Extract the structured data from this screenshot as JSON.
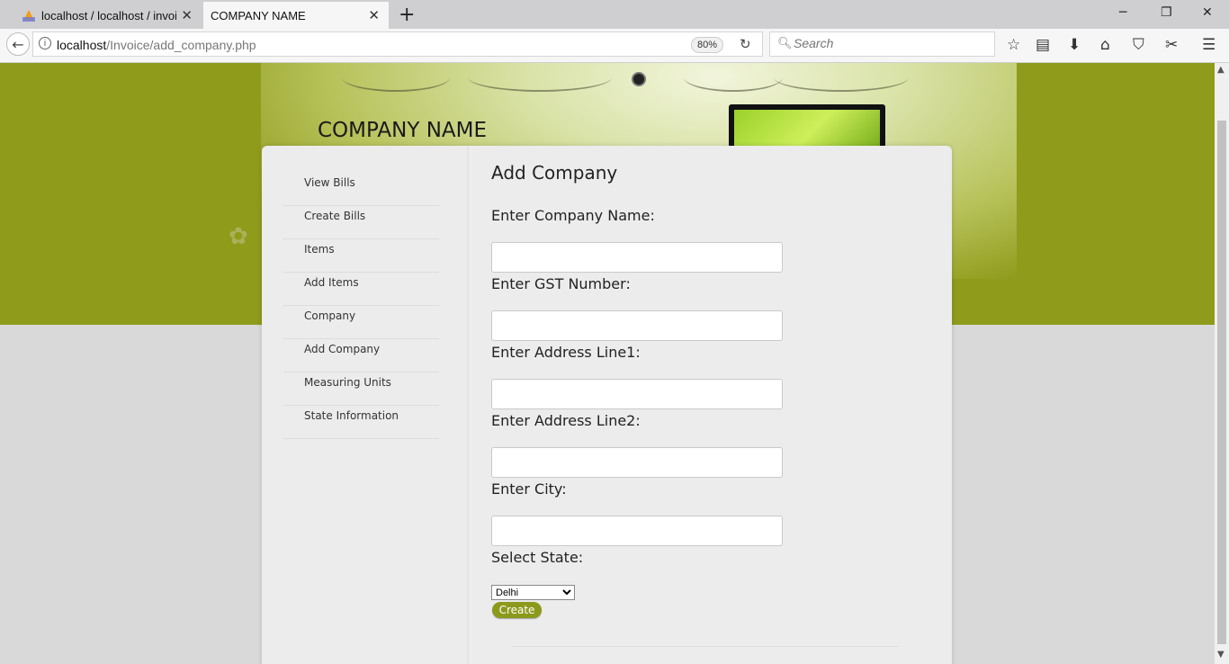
{
  "browser": {
    "tabs": [
      {
        "title": "localhost / localhost / invoice"
      },
      {
        "title": "COMPANY NAME"
      }
    ],
    "url_host": "localhost",
    "url_path": "/Invoice/add_company.php",
    "zoom": "80%",
    "search_placeholder": "Search"
  },
  "page": {
    "company_name": "COMPANY NAME",
    "heading": "Add Company",
    "nav": [
      {
        "label": "View Bills"
      },
      {
        "label": "Create Bills"
      },
      {
        "label": "Items"
      },
      {
        "label": "Add Items"
      },
      {
        "label": "Company"
      },
      {
        "label": "Add Company"
      },
      {
        "label": "Measuring Units"
      },
      {
        "label": "State Information"
      }
    ],
    "fields": [
      {
        "label": "Enter Company Name:",
        "value": ""
      },
      {
        "label": "Enter GST Number:",
        "value": ""
      },
      {
        "label": "Enter Address Line1:",
        "value": ""
      },
      {
        "label": "Enter Address Line2:",
        "value": ""
      },
      {
        "label": "Enter City:",
        "value": ""
      }
    ],
    "state_label": "Select State:",
    "state_selected": "Delhi",
    "create_label": "Create"
  },
  "colors": {
    "banner": "#8f9b1b",
    "button": "#8c9a1c"
  }
}
